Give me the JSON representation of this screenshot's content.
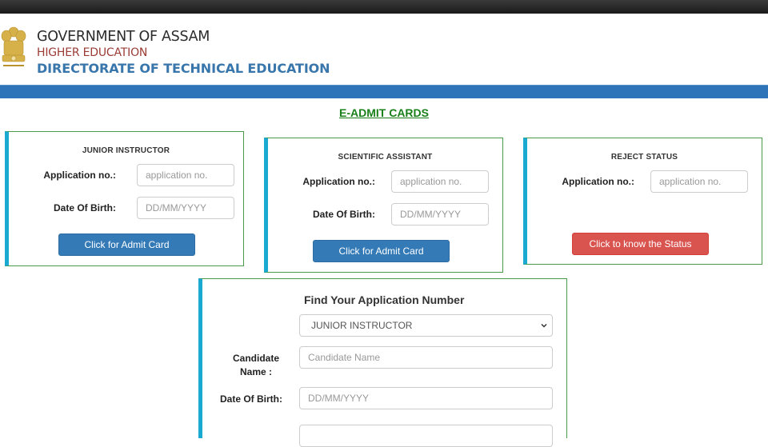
{
  "header": {
    "line1": "GOVERNMENT OF ASSAM",
    "line2": "HIGHER EDUCATION",
    "line3": "DIRECTORATE OF TECHNICAL EDUCATION",
    "emblem": "national-emblem-icon"
  },
  "page_title": "E-ADMIT CARDS",
  "colors": {
    "primary_blue": "#337ab7",
    "danger_red": "#d9534f",
    "title_green": "#198019",
    "panel_border_green": "#4a9a4a",
    "panel_accent_cyan": "#19a9d1",
    "header_bar_blue": "#2e74b8"
  },
  "panels": [
    {
      "title": "JUNIOR INSTRUCTOR",
      "app_label": "Application no.:",
      "app_placeholder": "application no.",
      "app_value": "",
      "dob_label": "Date Of Birth:",
      "dob_placeholder": "DD/MM/YYYY",
      "dob_value": "",
      "button": "Click for Admit Card"
    },
    {
      "title": "SCIENTIFIC ASSISTANT",
      "app_label": "Application no.:",
      "app_placeholder": "application no.",
      "app_value": "",
      "dob_label": "Date Of Birth:",
      "dob_placeholder": "DD/MM/YYYY",
      "dob_value": "",
      "button": "Click for Admit Card"
    },
    {
      "title": "REJECT STATUS",
      "app_label": "Application no.:",
      "app_placeholder": "application no.",
      "app_value": "",
      "button": "Click to know the Status"
    }
  ],
  "find": {
    "title": "Find Your Application Number",
    "post_select": "JUNIOR INSTRUCTOR",
    "name_label": "Candidate Name :",
    "name_placeholder": "Candidate Name",
    "name_value": "",
    "dob_label": "Date Of Birth:",
    "dob_placeholder": "DD/MM/YYYY",
    "dob_value": ""
  }
}
